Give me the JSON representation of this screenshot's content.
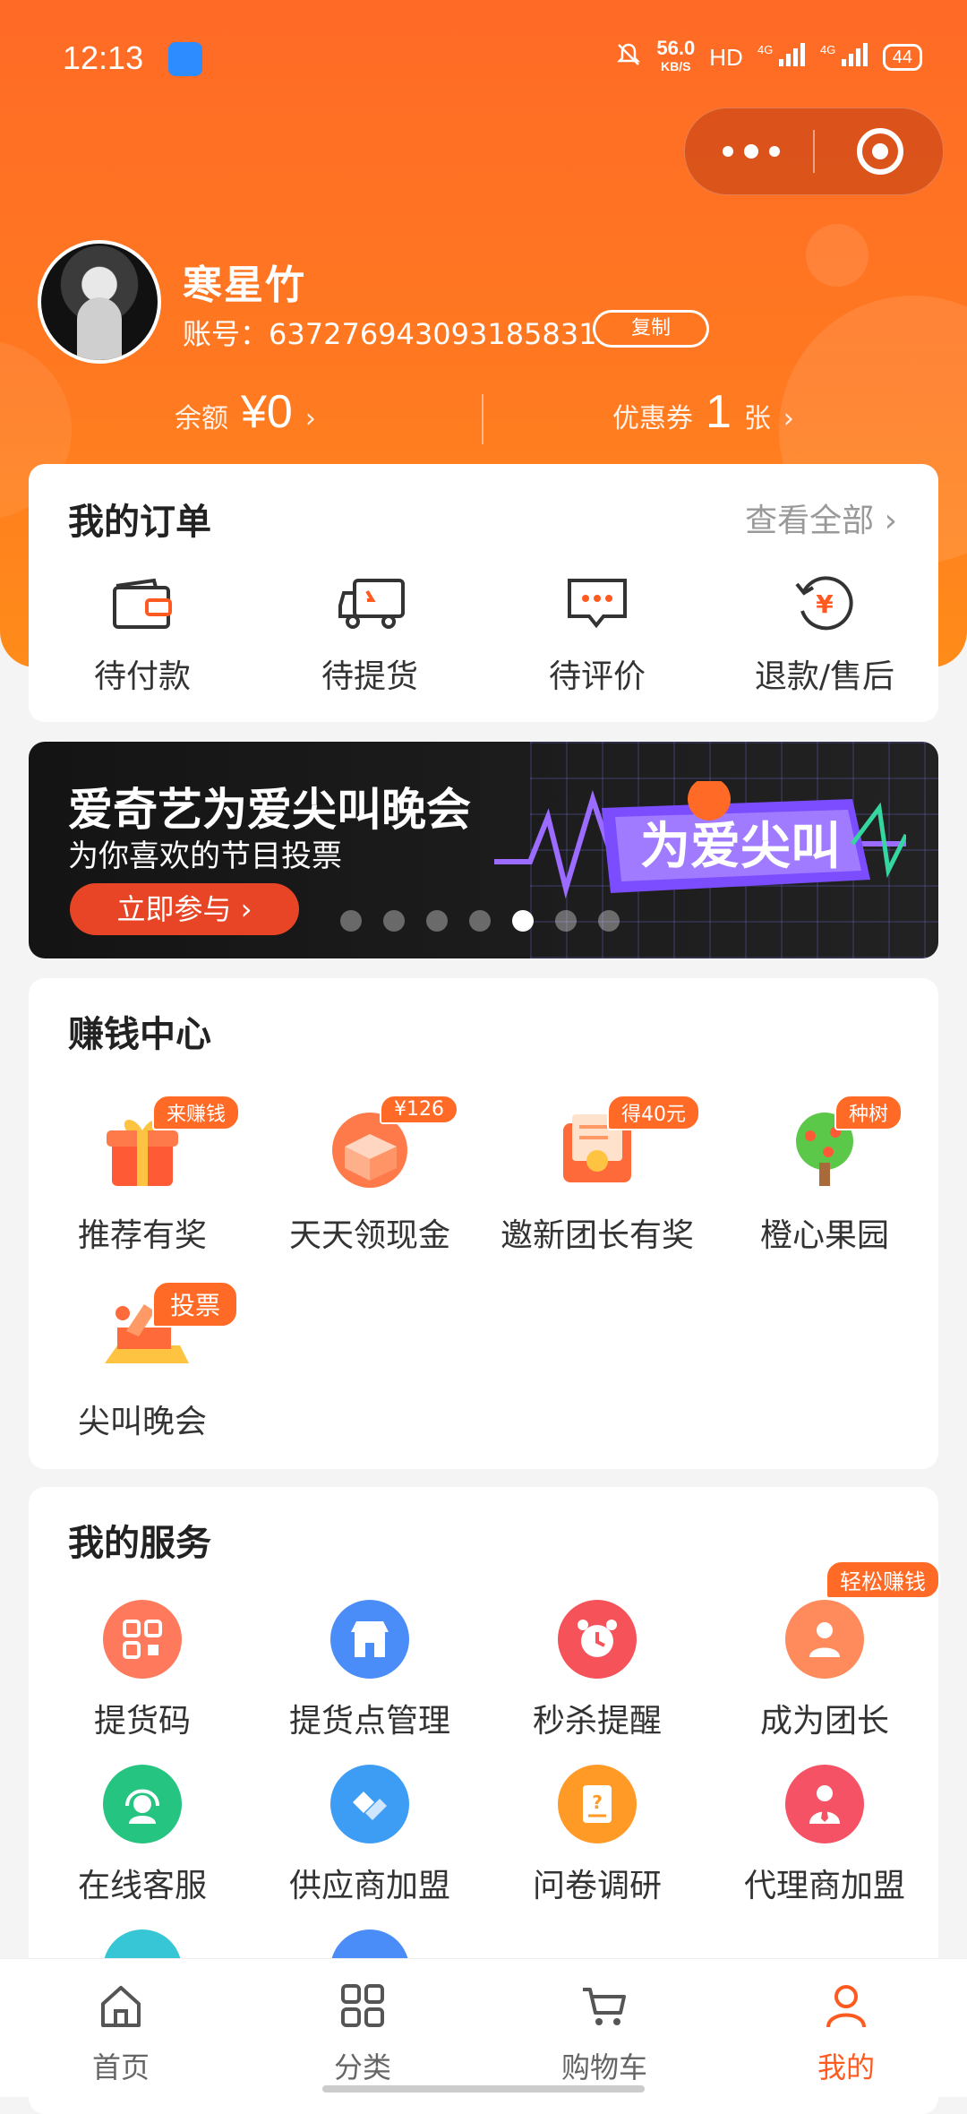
{
  "status_bar": {
    "time": "12:13",
    "speed_value": "56.0",
    "speed_unit": "KB/S",
    "hd": "HD",
    "net1": "4G",
    "net2": "4G",
    "battery": "44"
  },
  "profile": {
    "username": "寒星竹",
    "account_label": "账号：",
    "account_number": "637276943093185831",
    "copy_label": "复制",
    "balance_label": "余额",
    "balance_value": "¥0",
    "coupon_label": "优惠券",
    "coupon_value": "1",
    "coupon_unit": "张"
  },
  "orders": {
    "title": "我的订单",
    "view_all": "查看全部",
    "items": [
      {
        "label": "待付款",
        "icon": "wallet-icon"
      },
      {
        "label": "待提货",
        "icon": "truck-icon"
      },
      {
        "label": "待评价",
        "icon": "comment-icon"
      },
      {
        "label": "退款/售后",
        "icon": "refund-icon"
      }
    ]
  },
  "banner": {
    "title": "爱奇艺为爱尖叫晚会",
    "subtitle": "为你喜欢的节目投票",
    "button": "立即参与",
    "art_text": "为爱尖叫",
    "slides": 7,
    "active_slide": 5
  },
  "earn": {
    "title": "赚钱中心",
    "items": [
      {
        "label": "推荐有奖",
        "tag": "来赚钱",
        "icon": "gift-icon"
      },
      {
        "label": "天天领现金",
        "tag": "¥126",
        "icon": "cash-box-icon"
      },
      {
        "label": "邀新团长有奖",
        "tag": "得40元",
        "icon": "certificate-icon"
      },
      {
        "label": "橙心果园",
        "tag": "种树",
        "icon": "tree-icon"
      },
      {
        "label": "尖叫晚会",
        "tag": "投票",
        "icon": "vote-box-icon"
      }
    ]
  },
  "services": {
    "title": "我的服务",
    "items": [
      {
        "label": "提货码",
        "icon": "qr-code-icon",
        "color": "#ff7a5c"
      },
      {
        "label": "提货点管理",
        "icon": "store-icon",
        "color": "#4b8df8"
      },
      {
        "label": "秒杀提醒",
        "icon": "alarm-clock-icon",
        "color": "#f5525a"
      },
      {
        "label": "成为团长",
        "icon": "group-icon",
        "color": "#ff8a5c",
        "tag": "轻松赚钱"
      },
      {
        "label": "在线客服",
        "icon": "headset-icon",
        "color": "#26c481"
      },
      {
        "label": "供应商加盟",
        "icon": "handshake-icon",
        "color": "#3d9df5"
      },
      {
        "label": "问卷调研",
        "icon": "survey-icon",
        "color": "#ff9a26"
      },
      {
        "label": "代理商加盟",
        "icon": "agent-icon",
        "color": "#f55266"
      }
    ]
  },
  "tabbar": {
    "items": [
      {
        "label": "首页",
        "icon": "home-icon"
      },
      {
        "label": "分类",
        "icon": "category-icon"
      },
      {
        "label": "购物车",
        "icon": "cart-icon"
      },
      {
        "label": "我的",
        "icon": "user-icon"
      }
    ],
    "active": 3
  },
  "colors": {
    "brand": "#ff6a26",
    "active_tab": "#ff5a1f"
  }
}
